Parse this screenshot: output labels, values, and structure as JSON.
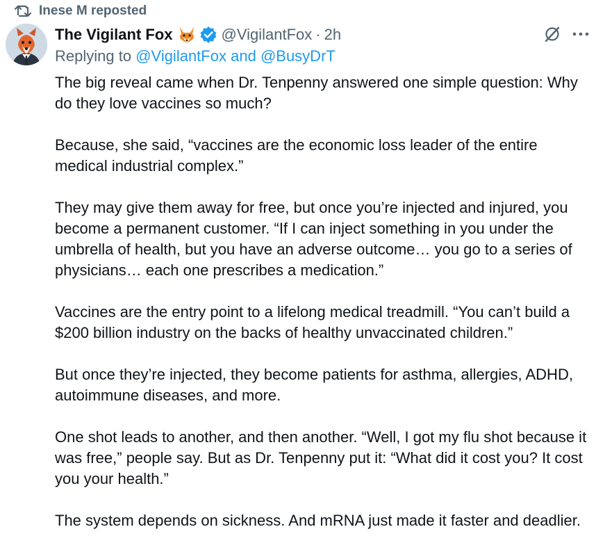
{
  "repost": {
    "icon": "repost-icon",
    "label": "Inese M reposted"
  },
  "author": {
    "avatar": "avatar",
    "display_name": "The Vigilant Fox",
    "emoji": "fox-emoji",
    "verified": "verified-icon",
    "verified_color": "#1d9bf0",
    "handle": "@VigilantFox",
    "separator": "·",
    "time": "2h"
  },
  "actions": {
    "grok_icon": "grok-icon",
    "more_icon": "more-icon"
  },
  "replying": {
    "prefix": "Replying to",
    "user1": "@VigilantFox",
    "conjunction": "and",
    "user2": "@BusyDrT",
    "link_color": "#1d9bf0"
  },
  "body": {
    "paragraphs": [
      "The big reveal came when Dr. Tenpenny answered one simple question: Why do they love vaccines so much?",
      "Because, she said, “vaccines are the economic loss leader of the entire medical industrial complex.”",
      "They may give them away for free, but once you’re injected and injured, you become a permanent customer. “If I can inject something in you under the umbrella of health, but you have an adverse outcome… you go to a series of physicians… each one prescribes a medication.”",
      "Vaccines are the entry point to a lifelong medical treadmill. “You can’t build a $200 billion industry on the backs of healthy unvaccinated children.”",
      "But once they’re injected, they become patients for asthma, allergies, ADHD, autoimmune diseases, and more.",
      "One shot leads to another, and then another. “Well, I got my flu shot because it was free,” people say. But as Dr. Tenpenny put it: “What did it cost you? It cost you your health.”",
      "The system depends on sickness. And mRNA just made it faster and deadlier."
    ]
  }
}
